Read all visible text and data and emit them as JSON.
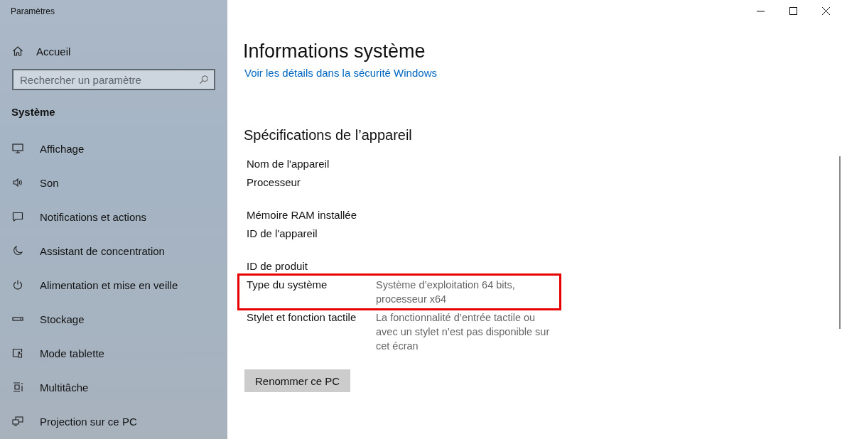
{
  "window": {
    "title": "Paramètres"
  },
  "sidebar": {
    "home": {
      "label": "Accueil"
    },
    "search": {
      "placeholder": "Rechercher un paramètre"
    },
    "section": "Système",
    "items": [
      {
        "label": "Affichage",
        "selected": false
      },
      {
        "label": "Son",
        "selected": false
      },
      {
        "label": "Notifications et actions",
        "selected": false
      },
      {
        "label": "Assistant de concentration",
        "selected": false
      },
      {
        "label": "Alimentation et mise en veille",
        "selected": false
      },
      {
        "label": "Stockage",
        "selected": false
      },
      {
        "label": "Mode tablette",
        "selected": false
      },
      {
        "label": "Multitâche",
        "selected": false
      },
      {
        "label": "Projection sur ce PC",
        "selected": false
      }
    ]
  },
  "main": {
    "title": "Informations système",
    "link": "Voir les détails dans la sécurité Windows",
    "specs_title": "Spécifications de l’appareil",
    "spec_groups": [
      [
        {
          "label": "Nom de l'appareil",
          "highlighted": false
        },
        {
          "label": "Processeur",
          "highlighted": false
        }
      ],
      [
        {
          "label": "Mémoire RAM installée",
          "highlighted": false
        },
        {
          "label": "ID de l'appareil",
          "highlighted": false
        }
      ],
      [
        {
          "label": "ID de produit",
          "highlighted": false
        },
        {
          "label": "Type du système",
          "value": "Système d’exploitation 64 bits, processeur x64",
          "highlighted": true
        },
        {
          "label": "Stylet et fonction tactile",
          "value": "La fonctionnalité d’entrée tactile ou avec un stylet n’est pas disponible sur cet écran",
          "highlighted": false
        }
      ]
    ],
    "button": "Renommer ce PC"
  }
}
